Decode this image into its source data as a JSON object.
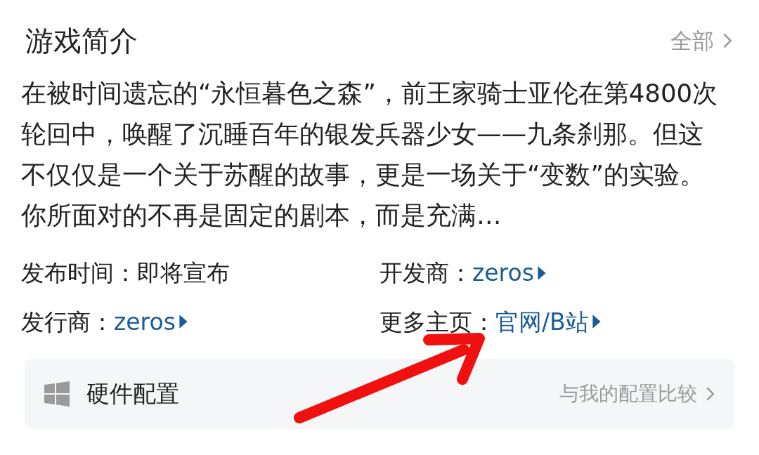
{
  "section": {
    "title": "游戏简介",
    "more_link": "全部"
  },
  "description": "在被时间遗忘的“永恒暮色之森”，前王家骑士亚伦在第4800次轮回中，唤醒了沉睡百年的银发兵器少女——九条刹那。但这不仅仅是一个关于苏醒的故事，更是一场关于“变数”的实验。你所面对的不再是固定的剧本，而是充满…",
  "info": [
    {
      "label": "发布时间：",
      "value": "即将宣布",
      "kind": "text"
    },
    {
      "label": "开发商：",
      "value": "zeros",
      "kind": "link"
    },
    {
      "label": "发行商：",
      "value": "zeros",
      "kind": "link"
    },
    {
      "label": "更多主页：",
      "value": "官网/B站",
      "kind": "link"
    }
  ],
  "hardware": {
    "title": "硬件配置",
    "compare_link": "与我的配置比较"
  },
  "annotation": {
    "kind": "arrow"
  }
}
